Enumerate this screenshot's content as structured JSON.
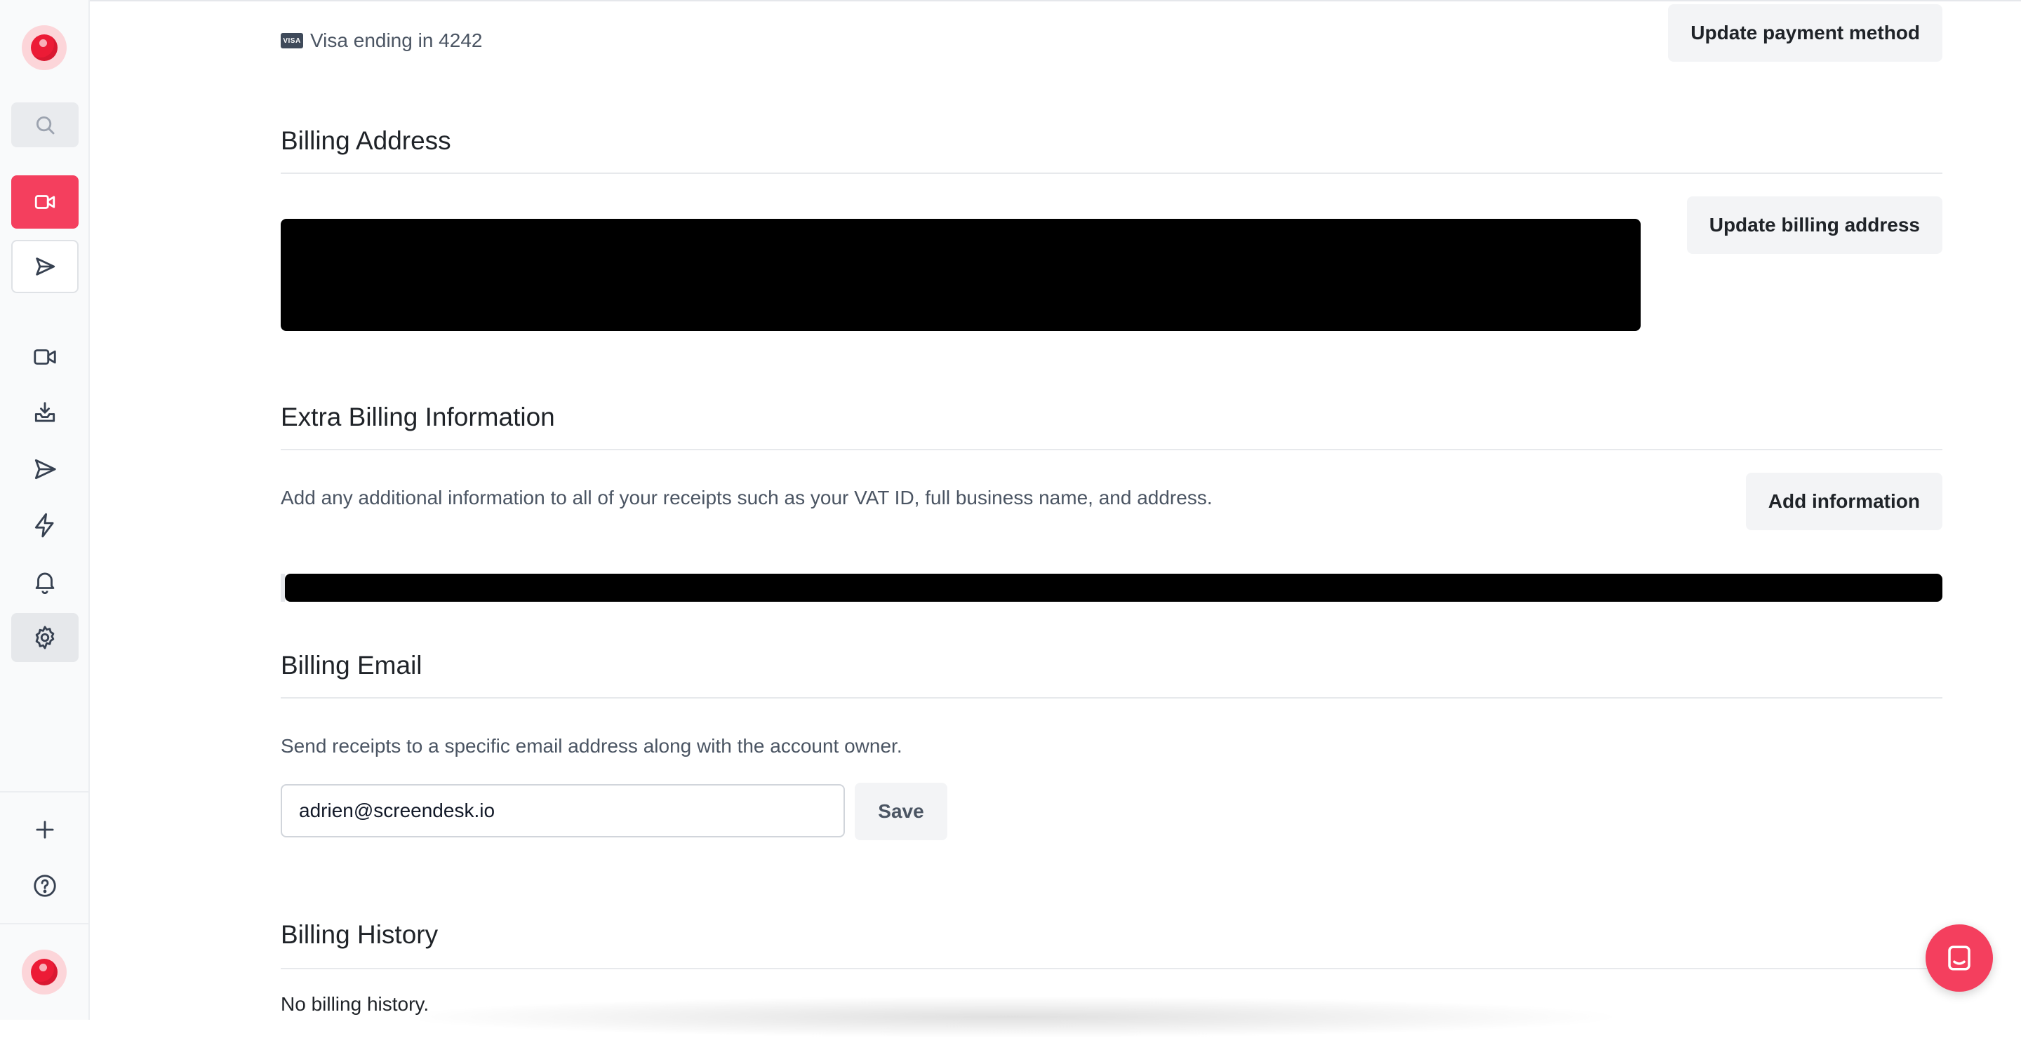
{
  "sidebar": {
    "logo": "app-logo",
    "search_icon": "search-icon",
    "record_icon": "video-camera-icon",
    "send_icon": "send-icon",
    "nav": [
      {
        "name": "videos",
        "icon": "video-icon"
      },
      {
        "name": "inbox",
        "icon": "inbox-download-icon"
      },
      {
        "name": "sent",
        "icon": "send-icon"
      },
      {
        "name": "automations",
        "icon": "lightning-icon"
      },
      {
        "name": "notifications",
        "icon": "bell-icon"
      },
      {
        "name": "settings",
        "icon": "gear-icon",
        "active": true
      }
    ],
    "add_icon": "plus-icon",
    "help_icon": "help-circle-icon",
    "user_avatar": "app-logo"
  },
  "payment": {
    "card_brand": "VISA",
    "card_text": "Visa ending in 4242",
    "update_button": "Update payment method"
  },
  "billing_address": {
    "title": "Billing Address",
    "update_button": "Update billing address"
  },
  "extra_info": {
    "title": "Extra Billing Information",
    "description": "Add any additional information to all of your receipts such as your VAT ID, full business name, and address.",
    "add_button": "Add information"
  },
  "billing_email": {
    "title": "Billing Email",
    "description": "Send receipts to a specific email address along with the account owner.",
    "email_value": "adrien@screendesk.io",
    "save_button": "Save"
  },
  "billing_history": {
    "title": "Billing History",
    "empty_text": "No billing history."
  },
  "colors": {
    "accent": "#f43f5e",
    "logo_red": "#ec1b36",
    "button_bg": "#f3f4f6"
  }
}
